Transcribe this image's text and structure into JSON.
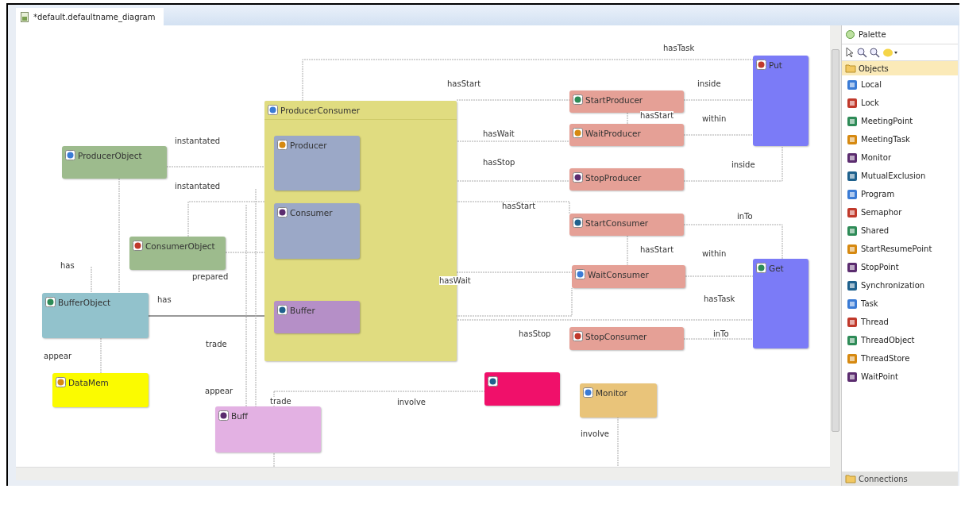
{
  "editor_tab": {
    "title": "*default.defaultname_diagram",
    "selected": true
  },
  "nodes": [
    {
      "label": "ProducerConsumer",
      "kind": "container",
      "color": "#e0dc80"
    },
    {
      "label": "Put",
      "kind": "node",
      "color": "#7b7bf7"
    },
    {
      "label": "StartProducer",
      "kind": "node",
      "color": "#e5a096"
    },
    {
      "label": "WaitProducer",
      "kind": "node",
      "color": "#e5a096"
    },
    {
      "label": "StopProducer",
      "kind": "node",
      "color": "#e5a096"
    },
    {
      "label": "StartConsumer",
      "kind": "node",
      "color": "#e5a096"
    },
    {
      "label": "WaitConsumer",
      "kind": "node",
      "color": "#e5a096"
    },
    {
      "label": "StopConsumer",
      "kind": "node",
      "color": "#e5a096"
    },
    {
      "label": "Get",
      "kind": "node",
      "color": "#7b7bf7"
    },
    {
      "label": "Producer",
      "kind": "node",
      "color": "#9ba8c7"
    },
    {
      "label": "Consumer",
      "kind": "node",
      "color": "#9ba8c7"
    },
    {
      "label": "Buffer",
      "kind": "node",
      "color": "#b58fc7"
    },
    {
      "label": "ProducerObject",
      "kind": "node",
      "color": "#9dbb8d"
    },
    {
      "label": "ConsumerObject",
      "kind": "node",
      "color": "#9dbb8d"
    },
    {
      "label": "BufferObject",
      "kind": "node",
      "color": "#92c2cc"
    },
    {
      "label": "DataMem",
      "kind": "node",
      "color": "#fbfb00"
    },
    {
      "label": "Buff",
      "kind": "node",
      "color": "#e3b1e3"
    },
    {
      "kind": "node",
      "color": "#f0106a"
    },
    {
      "label": "Monitor",
      "kind": "node",
      "color": "#e9c47a"
    }
  ],
  "edge_labels": [
    "hasTask",
    "hasStart",
    "inside",
    "hasStart",
    "within",
    "hasWait",
    "hasStop",
    "inside",
    "instantated",
    "instantated",
    "hasStart",
    "inTo",
    "hasStart",
    "within",
    "has",
    "prepared",
    "hasWait",
    "has",
    "hasTask",
    "trade",
    "hasStop",
    "inTo",
    "appear",
    "appear",
    "trade",
    "involve",
    "involve"
  ],
  "palette": {
    "title": "Palette",
    "drawers": [
      {
        "label": "Objects",
        "expanded": true,
        "items": [
          "Local",
          "Lock",
          "MeetingPoint",
          "MeetingTask",
          "Monitor",
          "MutualExclusion",
          "Program",
          "Semaphor",
          "Shared",
          "StartResumePoint",
          "StopPoint",
          "Synchronization",
          "Task",
          "Thread",
          "ThreadObject",
          "ThreadStore",
          "WaitPoint"
        ]
      },
      {
        "label": "Connections",
        "expanded": false
      }
    ]
  }
}
